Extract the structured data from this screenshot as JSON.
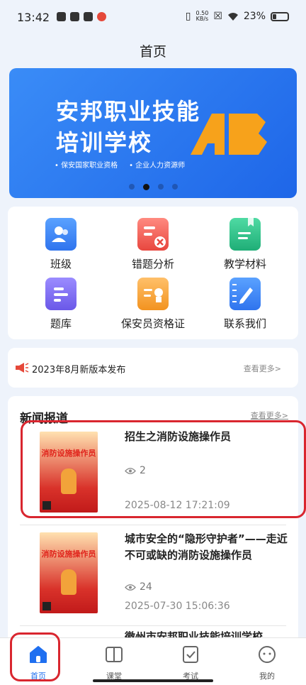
{
  "status_bar": {
    "time": "13:42",
    "net_speed": "0.50",
    "net_unit": "KB/s",
    "battery": "23%"
  },
  "page_title": "首页",
  "banner": {
    "line1": "安邦职业技能",
    "line2": "培训学校",
    "tag1": "• 保安国家职业资格",
    "tag2": "• 企业人力资源师",
    "logo_text": "AB",
    "slides": 4,
    "active_slide": 1
  },
  "grid": [
    {
      "label": "班级",
      "icon": "class-icon",
      "color": "#3d8af7"
    },
    {
      "label": "错题分析",
      "icon": "error-analysis-icon",
      "color": "#f0625a"
    },
    {
      "label": "教学材料",
      "icon": "teaching-material-icon",
      "color": "#2cc08a"
    },
    {
      "label": "题库",
      "icon": "question-bank-icon",
      "color": "#7b6cf0"
    },
    {
      "label": "保安员资格证",
      "icon": "certificate-icon",
      "color": "#f5a23c"
    },
    {
      "label": "联系我们",
      "icon": "contact-icon",
      "color": "#3d8af7"
    }
  ],
  "notice": {
    "text": "2023年8月新版本发布",
    "more": "查看更多>"
  },
  "news": {
    "header": "新闻报道",
    "more": "查看更多>",
    "poster_title": "消防设施操作员",
    "items": [
      {
        "title": "招生之消防设施操作员",
        "views": "2",
        "date": "2025-08-12 17:21:09"
      },
      {
        "title": "城市安全的“隐形守护者”——走近不可或缺的消防设施操作员",
        "views": "24",
        "date": "2025-07-30 15:06:36"
      },
      {
        "title": "徽州市安邦职业技能培训学校",
        "views": "",
        "date": ""
      }
    ]
  },
  "tabbar": [
    {
      "label": "首页",
      "icon": "home-icon",
      "active": true
    },
    {
      "label": "课堂",
      "icon": "book-icon",
      "active": false
    },
    {
      "label": "考试",
      "icon": "exam-icon",
      "active": false
    },
    {
      "label": "我的",
      "icon": "profile-icon",
      "active": false
    }
  ],
  "colors": {
    "accent": "#1f6ff0",
    "highlight": "#d9262f"
  }
}
